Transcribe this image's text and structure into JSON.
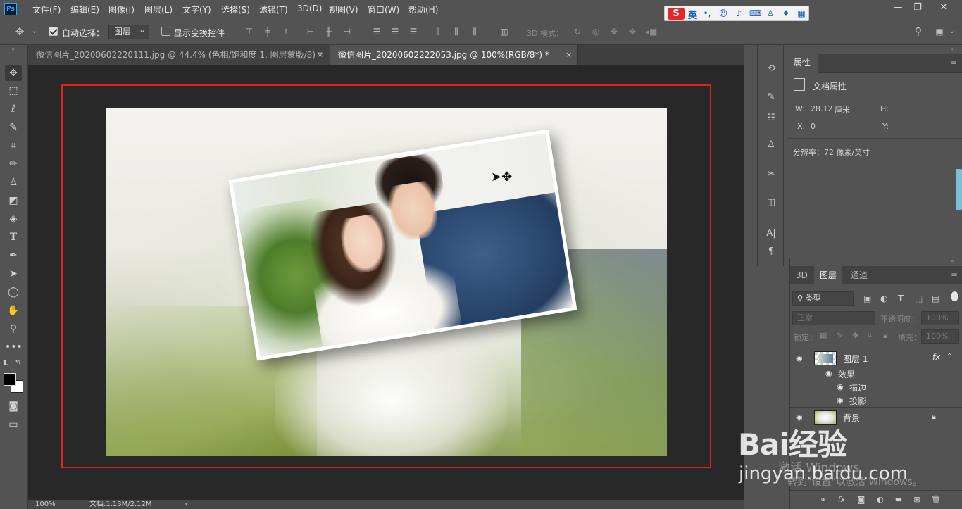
{
  "app": {
    "logo": "Ps"
  },
  "menu": [
    "文件(F)",
    "编辑(E)",
    "图像(I)",
    "图层(L)",
    "文字(Y)",
    "选择(S)",
    "滤镜(T)",
    "3D(D)",
    "视图(V)",
    "窗口(W)",
    "帮助(H)"
  ],
  "ime": {
    "logo": "S",
    "lang": "英",
    "icons": [
      "punctuation-icon",
      "emoji-icon",
      "mic-icon",
      "keyboard-icon",
      "user-icon",
      "shirt-icon",
      "grid-icon"
    ]
  },
  "options_bar": {
    "auto_select_label": "自动选择：",
    "auto_select_checked": true,
    "auto_select_value": "图层",
    "show_transform_label": "显示变换控件",
    "show_transform_checked": false,
    "mode3d_label": "3D 模式："
  },
  "tabs": [
    {
      "label": "微信图片_20200602220111.jpg @ 44.4% (色相/饱和度 1, 图层蒙版/8) *",
      "active": false
    },
    {
      "label": "微信图片_20200602222053.jpg @ 100%(RGB/8*) *",
      "active": true
    }
  ],
  "tab_close": "×",
  "status": {
    "zoom": "100%",
    "doc": "文档:1.13M/2.12M",
    "arrow": "›"
  },
  "properties": {
    "title": "属性",
    "section": "文档属性",
    "w_label": "W:",
    "w_value": "28.12",
    "w_unit": "厘米",
    "h_label": "H:",
    "x_label": "X:",
    "x_value": "0",
    "y_label": "Y:",
    "resolution": "分辨率：72 像素/英寸"
  },
  "layers_panel": {
    "tabs": [
      "3D",
      "图层",
      "通道"
    ],
    "active_tab": "图层",
    "filter_label": "类型",
    "blend_mode": "正常",
    "opacity_label": "不透明度：",
    "opacity_value": "100%",
    "lock_label": "锁定：",
    "fill_label": "填充：",
    "fill_value": "100%",
    "layers": [
      {
        "name": "图层 1",
        "fx": "fx",
        "effects_label": "效果",
        "effects": [
          "描边",
          "投影"
        ]
      },
      {
        "name": "背景",
        "locked": true
      }
    ]
  },
  "watermark": {
    "brand": "Bai经验",
    "site": "jingyan.baidu.com",
    "win1": "激活 Windows",
    "win2": "转到\"设置\"以激活 Windows。"
  }
}
